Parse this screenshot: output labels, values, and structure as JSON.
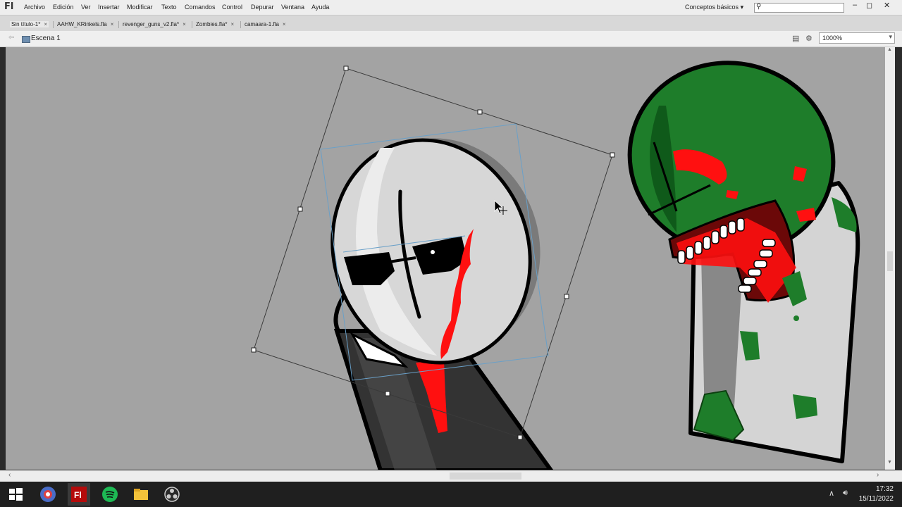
{
  "app": {
    "logo": "Fl"
  },
  "menu": [
    "Archivo",
    "Edición",
    "Ver",
    "Insertar",
    "Modificar",
    "Texto",
    "Comandos",
    "Control",
    "Depurar",
    "Ventana",
    "Ayuda"
  ],
  "workspace": {
    "label": "Conceptos básicos"
  },
  "search": {
    "placeholder": ""
  },
  "window_controls": [
    "–",
    "◻",
    "✕"
  ],
  "tabs": [
    {
      "label": "Sin título-1*",
      "active": true
    },
    {
      "label": "AAHW_KRinkels.fla",
      "active": false
    },
    {
      "label": "revenger_guns_v2.fla*",
      "active": false
    },
    {
      "label": "Zombies.fla*",
      "active": false
    },
    {
      "label": "camaara-1.fla",
      "active": false
    }
  ],
  "scene": {
    "label": "Escena 1"
  },
  "zoom": {
    "value": "1000%"
  },
  "taskbar": {
    "icons": [
      "windows-start-icon",
      "chrome-icon",
      "flash-icon",
      "spotify-icon",
      "file-explorer-icon",
      "obs-icon"
    ],
    "time": "17:32",
    "date": "15/11/2022"
  },
  "colors": {
    "stage": "#a3a3a3",
    "selection": "#3a3a3a",
    "zombie_green": "#1e7d2a",
    "blood": "#ff1010"
  }
}
